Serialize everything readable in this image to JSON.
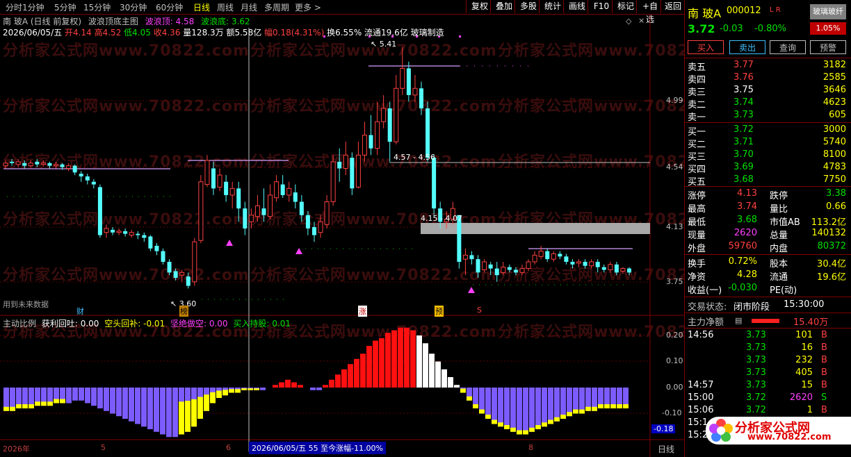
{
  "toolbar": {
    "periods": [
      "分时",
      "1分钟",
      "5分钟",
      "15分钟",
      "30分钟",
      "60分钟",
      "日线",
      "周线",
      "月线",
      "多周期",
      "更多 >"
    ],
    "selected": "日线",
    "right_buttons": [
      "复权",
      "叠加",
      "多股",
      "统计",
      "画线",
      "F10",
      "标记",
      "+自选",
      "返回"
    ]
  },
  "chart_header": {
    "line1_name": "南 玻A (日线 前复权)",
    "line1_indicator": "波浪顶底主图",
    "wave_top_label": "波浪顶: 4.58",
    "wave_bottom_label": "波浪底: 3.62",
    "date": "2026/06/05/五",
    "open": "开4.14",
    "high": "高4.52",
    "low": "低4.05",
    "close": "收4.36",
    "volume": "量128.3万",
    "amount": "额5.58亿",
    "amplitude": "幅0.18(4.31%)",
    "turnover": "换6.55%",
    "float_cap": "流通19.6亿",
    "sector": "玻璃制造"
  },
  "annotations": {
    "high_price": "5.41",
    "low_price": "3.60",
    "range1": "4.57 - 4.56",
    "range2": "4.15 - 4.07",
    "future_text": "用到未来数据",
    "marker_cai": "财",
    "marker_bang": "榜",
    "marker_zhang": "涨",
    "marker_yu": "预",
    "marker_s": "S"
  },
  "price_axis": [
    "4.99",
    "4.54",
    "4.13",
    "3.75"
  ],
  "indicator": {
    "title": "主动比例",
    "profit_label": "获利回吐: 0.00",
    "short_label": "空头回补: -0.01",
    "firm_short_label": "坚绝做空: 0.00",
    "buy_hold_label": "买入持股: 0.01",
    "axis": [
      "0.20",
      "0.10",
      "0.00",
      "-0.10"
    ],
    "current_value": "-0.18"
  },
  "bottom_axis": {
    "year": "2026年",
    "m5": "5",
    "m6": "6",
    "m8": "8",
    "info": "2026/06/05/五 55 至今涨幅-11.00%",
    "period_tab": "日线"
  },
  "watermark": "分析家公式网www.70822.com",
  "chart_data": {
    "type": "candlestick",
    "title": "南 玻A (日线 前复权)",
    "ylim": [
      3.55,
      5.45
    ],
    "candles": [
      [
        4.52,
        4.54,
        4.5,
        4.56
      ],
      [
        4.55,
        4.54,
        4.52,
        4.57
      ],
      [
        4.53,
        4.55,
        4.51,
        4.57
      ],
      [
        4.54,
        4.52,
        4.5,
        4.56
      ],
      [
        4.52,
        4.54,
        4.51,
        4.56
      ],
      [
        4.55,
        4.53,
        4.51,
        4.57
      ],
      [
        4.53,
        4.54,
        4.52,
        4.56
      ],
      [
        4.54,
        4.52,
        4.5,
        4.55
      ],
      [
        4.52,
        4.53,
        4.5,
        4.55
      ],
      [
        4.53,
        4.51,
        4.49,
        4.54
      ],
      [
        4.5,
        4.52,
        4.48,
        4.54
      ],
      [
        4.52,
        4.47,
        4.45,
        4.53
      ],
      [
        4.46,
        4.44,
        4.4,
        4.48
      ],
      [
        4.44,
        4.41,
        4.38,
        4.46
      ],
      [
        4.4,
        4.38,
        4.35,
        4.42
      ],
      [
        4.36,
        4.0,
        3.98,
        4.38
      ],
      [
        4.02,
        4.05,
        3.98,
        4.08
      ],
      [
        4.04,
        4.02,
        4.0,
        4.06
      ],
      [
        4.02,
        4.03,
        4.0,
        4.05
      ],
      [
        4.03,
        4.01,
        3.99,
        4.05
      ],
      [
        4.0,
        4.02,
        3.98,
        4.04
      ],
      [
        4.01,
        4.0,
        3.97,
        4.03
      ],
      [
        4.0,
        3.98,
        3.95,
        4.02
      ],
      [
        3.99,
        3.9,
        3.88,
        4.0
      ],
      [
        3.92,
        3.88,
        3.85,
        3.94
      ],
      [
        3.88,
        3.8,
        3.78,
        3.9
      ],
      [
        3.8,
        3.72,
        3.7,
        3.82
      ],
      [
        3.73,
        3.68,
        3.66,
        3.75
      ],
      [
        3.7,
        3.72,
        3.65,
        3.74
      ],
      [
        3.69,
        3.62,
        3.6,
        3.72
      ],
      [
        3.65,
        3.95,
        3.62,
        3.98
      ],
      [
        3.96,
        4.4,
        3.94,
        4.45
      ],
      [
        4.38,
        4.56,
        4.36,
        4.6
      ],
      [
        4.5,
        4.35,
        4.3,
        4.55
      ],
      [
        4.36,
        4.45,
        4.33,
        4.5
      ],
      [
        4.4,
        4.3,
        4.25,
        4.45
      ],
      [
        4.3,
        4.35,
        4.2,
        4.4
      ],
      [
        4.35,
        4.2,
        4.1,
        4.4
      ],
      [
        4.2,
        4.05,
        4.0,
        4.25
      ],
      [
        4.1,
        4.15,
        4.05,
        4.2
      ],
      [
        4.14,
        4.22,
        4.1,
        4.3
      ],
      [
        4.2,
        4.15,
        4.1,
        4.35
      ],
      [
        4.14,
        4.3,
        4.12,
        4.38
      ],
      [
        4.28,
        4.4,
        4.25,
        4.45
      ],
      [
        4.38,
        4.3,
        4.28,
        4.45
      ],
      [
        4.3,
        4.35,
        4.25,
        4.4
      ],
      [
        4.32,
        4.25,
        4.2,
        4.38
      ],
      [
        4.25,
        4.15,
        4.1,
        4.3
      ],
      [
        4.15,
        4.05,
        4.0,
        4.18
      ],
      [
        4.06,
        4.0,
        3.95,
        4.1
      ],
      [
        4.02,
        4.1,
        3.98,
        4.15
      ],
      [
        4.08,
        4.25,
        4.05,
        4.3
      ],
      [
        4.25,
        4.55,
        4.22,
        4.6
      ],
      [
        4.55,
        4.5,
        4.4,
        4.65
      ],
      [
        4.5,
        4.6,
        4.45,
        4.7
      ],
      [
        4.58,
        4.35,
        4.3,
        4.62
      ],
      [
        4.36,
        4.6,
        4.35,
        4.7
      ],
      [
        4.6,
        4.75,
        4.55,
        4.85
      ],
      [
        4.75,
        4.65,
        4.6,
        4.9
      ],
      [
        4.65,
        4.85,
        4.6,
        5.0
      ],
      [
        4.85,
        4.95,
        4.8,
        5.05
      ],
      [
        4.95,
        4.7,
        4.55,
        5.0
      ],
      [
        4.7,
        5.1,
        4.68,
        5.2
      ],
      [
        5.1,
        5.25,
        5.05,
        5.41
      ],
      [
        5.25,
        5.05,
        5.0,
        5.3
      ],
      [
        5.05,
        5.1,
        5.0,
        5.2
      ],
      [
        5.1,
        4.95,
        4.9,
        5.15
      ],
      [
        4.95,
        4.58,
        4.55,
        5.0
      ],
      [
        4.58,
        4.2,
        4.15,
        4.6
      ],
      [
        4.2,
        4.1,
        4.05,
        4.25
      ],
      [
        4.1,
        4.12,
        4.05,
        4.18
      ],
      [
        4.12,
        4.2,
        4.08,
        4.25
      ],
      [
        4.15,
        3.8,
        3.75,
        4.15
      ],
      [
        3.82,
        3.85,
        3.7,
        3.9
      ],
      [
        3.85,
        3.82,
        3.78,
        3.88
      ],
      [
        3.82,
        3.72,
        3.68,
        3.85
      ],
      [
        3.74,
        3.8,
        3.72,
        3.82
      ],
      [
        3.78,
        3.75,
        3.7,
        3.8
      ],
      [
        3.75,
        3.7,
        3.65,
        3.8
      ],
      [
        3.72,
        3.76,
        3.7,
        3.8
      ],
      [
        3.76,
        3.74,
        3.72,
        3.78
      ],
      [
        3.74,
        3.72,
        3.7,
        3.76
      ],
      [
        3.72,
        3.75,
        3.7,
        3.78
      ],
      [
        3.75,
        3.8,
        3.73,
        3.82
      ],
      [
        3.8,
        3.85,
        3.78,
        3.88
      ],
      [
        3.84,
        3.88,
        3.82,
        3.92
      ],
      [
        3.88,
        3.82,
        3.8,
        3.9
      ],
      [
        3.82,
        3.86,
        3.8,
        3.88
      ],
      [
        3.86,
        3.84,
        3.82,
        3.88
      ],
      [
        3.84,
        3.8,
        3.78,
        3.86
      ],
      [
        3.8,
        3.78,
        3.75,
        3.82
      ],
      [
        3.79,
        3.8,
        3.76,
        3.82
      ],
      [
        3.8,
        3.77,
        3.75,
        3.82
      ],
      [
        3.77,
        3.8,
        3.75,
        3.82
      ],
      [
        3.8,
        3.76,
        3.72,
        3.82
      ],
      [
        3.76,
        3.74,
        3.72,
        3.78
      ],
      [
        3.74,
        3.78,
        3.72,
        3.8
      ],
      [
        3.78,
        3.72,
        3.7,
        3.8
      ],
      [
        3.73,
        3.75,
        3.71,
        3.76
      ],
      [
        3.75,
        3.72,
        3.7,
        3.76
      ]
    ],
    "histogram": [
      -0.09,
      -0.09,
      -0.08,
      -0.08,
      -0.08,
      -0.07,
      -0.07,
      -0.07,
      -0.06,
      -0.06,
      -0.06,
      -0.05,
      -0.05,
      -0.06,
      -0.07,
      -0.08,
      -0.09,
      -0.1,
      -0.11,
      -0.12,
      -0.13,
      -0.14,
      -0.15,
      -0.16,
      -0.17,
      -0.18,
      -0.19,
      -0.19,
      -0.18,
      -0.17,
      -0.15,
      -0.12,
      -0.09,
      -0.06,
      -0.04,
      -0.03,
      -0.02,
      -0.02,
      -0.01,
      -0.01,
      -0.01,
      -0.01,
      0.0,
      0.01,
      0.02,
      0.03,
      0.02,
      0.01,
      0.0,
      -0.01,
      -0.01,
      0.01,
      0.03,
      0.05,
      0.07,
      0.09,
      0.11,
      0.13,
      0.16,
      0.18,
      0.19,
      0.21,
      0.22,
      0.23,
      0.23,
      0.22,
      0.2,
      0.17,
      0.13,
      0.1,
      0.07,
      0.04,
      0.01,
      -0.02,
      -0.05,
      -0.08,
      -0.1,
      -0.12,
      -0.14,
      -0.15,
      -0.16,
      -0.17,
      -0.18,
      -0.18,
      -0.17,
      -0.16,
      -0.15,
      -0.14,
      -0.13,
      -0.12,
      -0.11,
      -0.1,
      -0.1,
      -0.09,
      -0.09,
      -0.08,
      -0.08,
      -0.08,
      -0.08,
      -0.08
    ]
  },
  "quote": {
    "name": "南 玻A",
    "code": "000012",
    "flags": "L R",
    "concept_tag": "玻璃玻纤",
    "price": "3.72",
    "change": "-0.03",
    "pct": "-0.80%",
    "concept_pct": "1.05%",
    "buttons": [
      "买入",
      "卖出",
      "查询",
      "预警"
    ],
    "asks": [
      {
        "label": "卖五",
        "price": "3.77",
        "vol": "3182"
      },
      {
        "label": "卖四",
        "price": "3.76",
        "vol": "2585"
      },
      {
        "label": "卖三",
        "price": "3.75",
        "vol": "3646"
      },
      {
        "label": "卖二",
        "price": "3.74",
        "vol": "4623"
      },
      {
        "label": "卖一",
        "price": "3.73",
        "vol": "605"
      }
    ],
    "bids": [
      {
        "label": "买一",
        "price": "3.72",
        "vol": "3000"
      },
      {
        "label": "买二",
        "price": "3.71",
        "vol": "5740"
      },
      {
        "label": "买三",
        "price": "3.70",
        "vol": "8100"
      },
      {
        "label": "买四",
        "price": "3.69",
        "vol": "4783"
      },
      {
        "label": "买五",
        "price": "3.68",
        "vol": "7750"
      }
    ],
    "stats": [
      {
        "l1": "涨停",
        "v1": "4.13",
        "l2": "跌停",
        "v2": "3.38"
      },
      {
        "l1": "最高",
        "v1": "3.74",
        "l2": "量比",
        "v2": "0.66"
      },
      {
        "l1": "最低",
        "v1": "3.68",
        "l2": "市值AB",
        "v2": "113.2亿"
      },
      {
        "l1": "现量",
        "v1": "2620",
        "l2": "总量",
        "v2": "140132"
      },
      {
        "l1": "外盘",
        "v1": "59760",
        "l2": "内盘",
        "v2": "80372"
      }
    ],
    "stats2": [
      {
        "l1": "换手",
        "v1": "0.72%",
        "l2": "股本",
        "v2": "30.4亿"
      },
      {
        "l1": "净资",
        "v1": "4.28",
        "l2": "流通",
        "v2": "19.6亿"
      },
      {
        "l1": "收益(一)",
        "v1": "-0.030",
        "l2": "PE(动)",
        "v2": ""
      }
    ],
    "trade_status_label": "交易状态:",
    "trade_status": "闭市阶段",
    "trade_time": "15:30:00",
    "main_force_label": "主力净额",
    "main_force_value": "15.40万",
    "ticks": [
      {
        "t": "14:56",
        "p": "3.73",
        "v": "101",
        "s": "B"
      },
      {
        "t": "",
        "p": "3.73",
        "v": "16",
        "s": "B"
      },
      {
        "t": "",
        "p": "3.73",
        "v": "232",
        "s": "B"
      },
      {
        "t": "",
        "p": "3.73",
        "v": "405",
        "s": "B"
      },
      {
        "t": "14:57",
        "p": "3.73",
        "v": "15",
        "s": "B"
      },
      {
        "t": "15:00",
        "p": "3.72",
        "v": "2620",
        "s": "S"
      },
      {
        "t": "15:06",
        "p": "3.72",
        "v": "1",
        "s": "B"
      },
      {
        "t": "15:1",
        "p": "",
        "v": "",
        "s": ""
      },
      {
        "t": "15:2",
        "p": "",
        "v": "",
        "s": ""
      }
    ],
    "logo_text": "分析家公式网",
    "logo_url": "www.70822.com"
  }
}
